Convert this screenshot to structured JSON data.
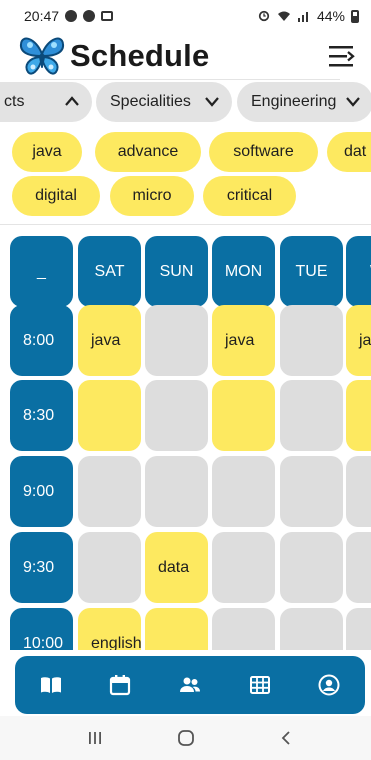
{
  "status": {
    "time": "20:47",
    "battery": "44%"
  },
  "header": {
    "title": "Schedule"
  },
  "filters": [
    {
      "label": "cts",
      "chevron": "up"
    },
    {
      "label": "Specialities",
      "chevron": "down"
    },
    {
      "label": "Engineering",
      "chevron": "down"
    }
  ],
  "tags": [
    "java",
    "advance",
    "software",
    "dat",
    "digital",
    "micro",
    "critical"
  ],
  "schedule": {
    "corner": "_",
    "days": [
      "SAT",
      "SUN",
      "MON",
      "TUE",
      "W"
    ],
    "rows": [
      {
        "time": "8:00",
        "cells": [
          {
            "label": "java",
            "filled": true
          },
          {
            "label": "",
            "filled": false
          },
          {
            "label": "java",
            "filled": true
          },
          {
            "label": "",
            "filled": false
          },
          {
            "label": "ja",
            "filled": true
          }
        ]
      },
      {
        "time": "8:30",
        "cells": [
          {
            "label": "",
            "filled": true
          },
          {
            "label": "",
            "filled": false
          },
          {
            "label": "",
            "filled": true
          },
          {
            "label": "",
            "filled": false
          },
          {
            "label": "",
            "filled": true
          }
        ]
      },
      {
        "time": "9:00",
        "cells": [
          {
            "label": "",
            "filled": false
          },
          {
            "label": "",
            "filled": false
          },
          {
            "label": "",
            "filled": false
          },
          {
            "label": "",
            "filled": false
          },
          {
            "label": "",
            "filled": false
          }
        ]
      },
      {
        "time": "9:30",
        "cells": [
          {
            "label": "",
            "filled": false
          },
          {
            "label": "data",
            "filled": true
          },
          {
            "label": "",
            "filled": false
          },
          {
            "label": "",
            "filled": false
          },
          {
            "label": "",
            "filled": false
          }
        ]
      },
      {
        "time": "10:00",
        "cells": [
          {
            "label": "english",
            "filled": true
          },
          {
            "label": "",
            "filled": true
          },
          {
            "label": "",
            "filled": false
          },
          {
            "label": "",
            "filled": false
          },
          {
            "label": "",
            "filled": false
          }
        ]
      }
    ]
  },
  "bottom_nav": [
    {
      "name": "book-icon"
    },
    {
      "name": "calendar-icon"
    },
    {
      "name": "people-icon"
    },
    {
      "name": "table-icon"
    },
    {
      "name": "account-icon"
    }
  ],
  "system_nav": [
    "recent-apps-icon",
    "home-icon",
    "back-icon"
  ],
  "colors": {
    "primary": "#0a6fa3",
    "accent": "#fde960",
    "empty_cell": "#dddddd",
    "chip_bg": "#e3e3e3"
  }
}
